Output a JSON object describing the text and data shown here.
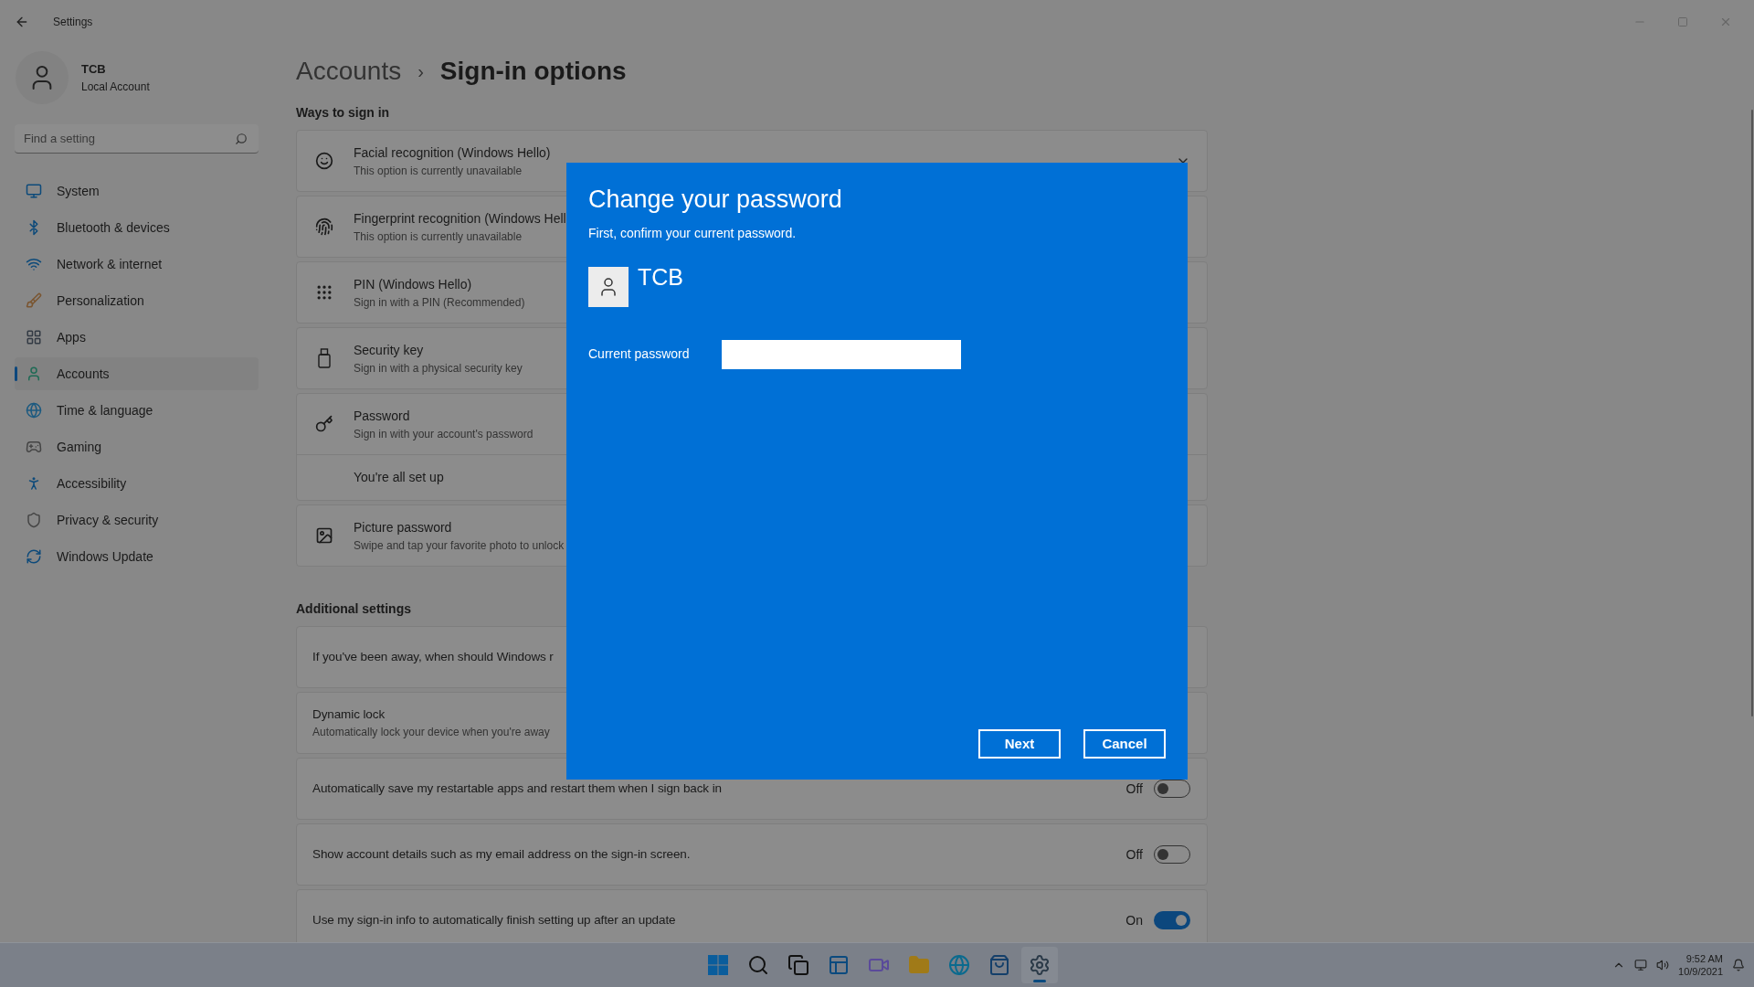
{
  "window": {
    "title": "Settings"
  },
  "profile": {
    "name": "TCB",
    "type": "Local Account"
  },
  "search": {
    "placeholder": "Find a setting"
  },
  "nav": [
    {
      "label": "System",
      "selected": false
    },
    {
      "label": "Bluetooth & devices",
      "selected": false
    },
    {
      "label": "Network & internet",
      "selected": false
    },
    {
      "label": "Personalization",
      "selected": false
    },
    {
      "label": "Apps",
      "selected": false
    },
    {
      "label": "Accounts",
      "selected": true
    },
    {
      "label": "Time & language",
      "selected": false
    },
    {
      "label": "Gaming",
      "selected": false
    },
    {
      "label": "Accessibility",
      "selected": false
    },
    {
      "label": "Privacy & security",
      "selected": false
    },
    {
      "label": "Windows Update",
      "selected": false
    }
  ],
  "breadcrumb": {
    "parent": "Accounts",
    "separator": "›",
    "current": "Sign-in options"
  },
  "ways": {
    "heading": "Ways to sign in",
    "items": [
      {
        "title": "Facial recognition (Windows Hello)",
        "subtitle": "This option is currently unavailable",
        "expanded": false
      },
      {
        "title": "Fingerprint recognition (Windows Hell",
        "subtitle": "This option is currently unavailable"
      },
      {
        "title": "PIN (Windows Hello)",
        "subtitle": "Sign in with a PIN (Recommended)"
      },
      {
        "title": "Security key",
        "subtitle": "Sign in with a physical security key"
      },
      {
        "title": "Password",
        "subtitle": "Sign in with your account's password",
        "detail": "You're all set up"
      },
      {
        "title": "Picture password",
        "subtitle": "Swipe and tap your favorite photo to unlock"
      }
    ]
  },
  "additional": {
    "heading": "Additional settings",
    "items": [
      {
        "kind": "plain",
        "title": "If you've been away, when should Windows r"
      },
      {
        "kind": "plain",
        "title": "Dynamic lock",
        "subtitle": "Automatically lock your device when you're away"
      },
      {
        "kind": "toggle",
        "title": "Automatically save my restartable apps and restart them when I sign back in",
        "state": "Off",
        "on": false
      },
      {
        "kind": "toggle",
        "title": "Show account details such as my email address on the sign-in screen.",
        "state": "Off",
        "on": false
      },
      {
        "kind": "toggle",
        "title": "Use my sign-in info to automatically finish setting up after an update",
        "state": "On",
        "on": true
      }
    ]
  },
  "dialog": {
    "title": "Change your password",
    "subtitle": "First, confirm your current password.",
    "user": "TCB",
    "field_label": "Current password",
    "buttons": [
      "Next",
      "Cancel"
    ]
  },
  "taskbar": {
    "apps": [
      {
        "selected": false
      },
      {
        "selected": false
      },
      {
        "selected": false
      },
      {
        "selected": false
      },
      {
        "selected": false
      },
      {
        "selected": false
      },
      {
        "selected": false
      },
      {
        "selected": false
      },
      {
        "selected": true
      }
    ],
    "time": "9:52 AM",
    "date": "10/9/2021"
  }
}
